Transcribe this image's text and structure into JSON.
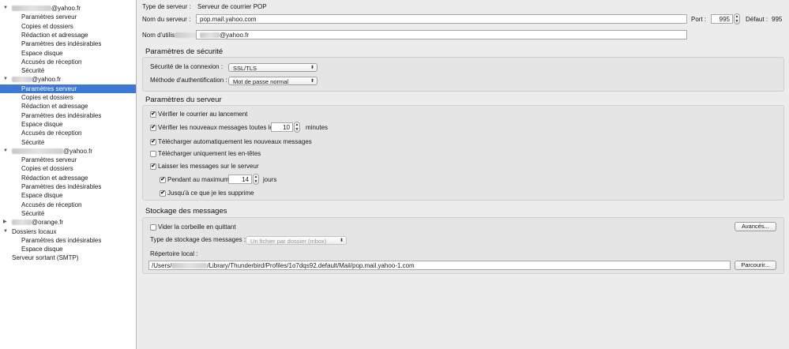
{
  "sidebar": {
    "accounts": [
      {
        "name_suffix": "@yahoo.fr",
        "blur_w": 50,
        "expanded": true,
        "children": [
          "Paramètres serveur",
          "Copies et dossiers",
          "Rédaction et adressage",
          "Paramètres des indésirables",
          "Espace disque",
          "Accusés de réception",
          "Sécurité"
        ]
      },
      {
        "name_suffix": "@yahoo.fr",
        "blur_w": 25,
        "expanded": true,
        "children": [
          "Paramètres serveur",
          "Copies et dossiers",
          "Rédaction et adressage",
          "Paramètres des indésirables",
          "Espace disque",
          "Accusés de réception",
          "Sécurité"
        ]
      },
      {
        "name_suffix": "@yahoo.fr",
        "blur_w": 65,
        "expanded": true,
        "children": [
          "Paramètres serveur",
          "Copies et dossiers",
          "Rédaction et adressage",
          "Paramètres des indésirables",
          "Espace disque",
          "Accusés de réception",
          "Sécurité"
        ]
      },
      {
        "name_suffix": "@orange.fr",
        "blur_w": 25,
        "expanded": false,
        "children": []
      },
      {
        "name_suffix": "Dossiers locaux",
        "blur_w": 0,
        "expanded": true,
        "children": [
          "Paramètres des indésirables",
          "Espace disque"
        ]
      }
    ],
    "smtp": "Serveur sortant (SMTP)",
    "selected": "Paramètres serveur"
  },
  "server": {
    "type_label": "Type de serveur :",
    "type_value": "Serveur de courrier POP",
    "name_label": "Nom du serveur :",
    "name_value": "pop.mail.yahoo.com",
    "port_label": "Port :",
    "port_value": "995",
    "default_label": "Défaut :",
    "default_value": "995",
    "user_label": "Nom d'utilis",
    "user_value_suffix": "@yahoo.fr"
  },
  "security": {
    "title": "Paramètres de sécurité",
    "conn_label": "Sécurité de la connexion :",
    "conn_value": "SSL/TLS",
    "auth_label": "Méthode d'authentification :",
    "auth_value": "Mot de passe normal"
  },
  "settings": {
    "title": "Paramètres du serveur",
    "check_login": "Vérifier le courrier au lancement",
    "check_every": "Vérifier les nouveaux messages toutes les",
    "check_every_value": "10",
    "minutes": "minutes",
    "auto_download": "Télécharger automatiquement les nouveaux messages",
    "headers_only": "Télécharger uniquement les en-têtes",
    "leave_on_server": "Laisser les messages sur le serveur",
    "max_days": "Pendant au maximum",
    "max_days_value": "14",
    "days": "jours",
    "until_deleted": "Jusqu'à ce que je les supprime"
  },
  "storage": {
    "title": "Stockage des messages",
    "empty_trash": "Vider la corbeille en quittant",
    "advanced": "Avancés...",
    "type_label": "Type de stockage des messages :",
    "type_value": "Un fichier par dossier (mbox)",
    "local_dir_label": "Répertoire local :",
    "path_prefix": "/Users/",
    "path_suffix": "/Library/Thunderbird/Profiles/1o7dqs92.default/Mail/pop.mail.yahoo-1.com",
    "browse": "Parcourir..."
  },
  "icons": {
    "check": "✔",
    "expanded": "triangle-down-icon",
    "collapsed": "triangle-right-icon"
  },
  "colors": {
    "selection": "#3b78d8",
    "panel": "#ececec"
  }
}
